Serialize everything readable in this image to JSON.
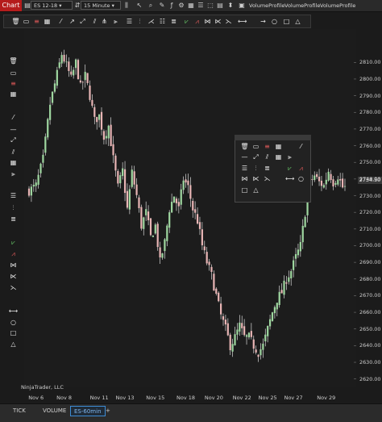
{
  "toolbar": {
    "chart_label": "Chart",
    "instrument": "ES 12-18",
    "interval": "15 Minute",
    "indicators": [
      "VolumeProfile",
      "VolumeProfile",
      "VolumeProfile"
    ]
  },
  "drawing_tools": {
    "top_icons": [
      "cursor-icon",
      "ruler-icon",
      "horizontal-line-icon",
      "fib-icon",
      "ray-icon",
      "trend-channel-icon",
      "andrews-pitchfork-icon",
      "regression-icon",
      "gann-fan-icon",
      "fib-extension-icon",
      "horizontal-lines-icon",
      "buy-arrow-icon",
      "sell-arrow-icon",
      "triangle-shape-icon",
      "rectangle-shape-icon",
      "arrow-line-icon",
      "ellipse-icon",
      "triangle-icon"
    ],
    "left_icons": [
      "trash-icon",
      "ruler-icon",
      "horizontal-line-icon",
      "line-icon",
      "ray-icon",
      "extended-line-icon",
      "channel-icon",
      "pitchfork-icon",
      "fib-retracement-icon",
      "fib-extension-icon",
      "fib-time-icon",
      "fib-circle-icon",
      "buy-marker-icon",
      "sell-marker-icon",
      "region-icon",
      "risk-reward-icon",
      "arrow-line-icon",
      "circle-icon",
      "triangle-icon"
    ]
  },
  "chart": {
    "last_price": "2734.50",
    "watermark": "NinjaTrader, LLC",
    "up_color": "#9fd7a0",
    "down_color": "#e8b5b5"
  },
  "chart_data": {
    "type": "candlestick",
    "ylim": [
      2615,
      2830
    ],
    "y_ticks": [
      2620,
      2630,
      2640,
      2650,
      2660,
      2670,
      2680,
      2690,
      2700,
      2710,
      2720,
      2730,
      2740,
      2750,
      2760,
      2770,
      2780,
      2790,
      2800,
      2810
    ],
    "y_tick_labels": [
      "2620.00",
      "2630.00",
      "2640.00",
      "2650.00",
      "2660.00",
      "2670.00",
      "2680.00",
      "2690.00",
      "2700.00",
      "2710.00",
      "2720.00",
      "2730.00",
      "2740.00",
      "2750.00",
      "2760.00",
      "2770.00",
      "2780.00",
      "2790.00",
      "2800.00",
      "2810.00"
    ],
    "x_tick_labels": [
      "Nov 6",
      "Nov 8",
      "Nov 11",
      "Nov 13",
      "Nov 15",
      "Nov 18",
      "Nov 20",
      "Nov 22",
      "Nov 25",
      "Nov 27",
      "Nov 29"
    ],
    "x_tick_index": [
      3,
      15,
      30,
      41,
      54,
      67,
      79,
      91,
      102,
      113,
      127
    ],
    "close_path": [
      [
        0,
        2733
      ],
      [
        3,
        2736
      ],
      [
        6,
        2752
      ],
      [
        9,
        2785
      ],
      [
        12,
        2803
      ],
      [
        14,
        2815
      ],
      [
        16,
        2808
      ],
      [
        18,
        2800
      ],
      [
        20,
        2810
      ],
      [
        22,
        2795
      ],
      [
        24,
        2802
      ],
      [
        26,
        2790
      ],
      [
        28,
        2775
      ],
      [
        30,
        2778
      ],
      [
        32,
        2765
      ],
      [
        34,
        2772
      ],
      [
        36,
        2752
      ],
      [
        38,
        2735
      ],
      [
        40,
        2745
      ],
      [
        42,
        2722
      ],
      [
        44,
        2744
      ],
      [
        46,
        2730
      ],
      [
        48,
        2712
      ],
      [
        50,
        2720
      ],
      [
        52,
        2705
      ],
      [
        54,
        2712
      ],
      [
        56,
        2690
      ],
      [
        58,
        2702
      ],
      [
        60,
        2722
      ],
      [
        62,
        2730
      ],
      [
        64,
        2722
      ],
      [
        66,
        2740
      ],
      [
        68,
        2735
      ],
      [
        70,
        2722
      ],
      [
        72,
        2715
      ],
      [
        74,
        2700
      ],
      [
        76,
        2690
      ],
      [
        78,
        2682
      ],
      [
        80,
        2670
      ],
      [
        82,
        2658
      ],
      [
        84,
        2650
      ],
      [
        86,
        2640
      ],
      [
        88,
        2645
      ],
      [
        90,
        2652
      ],
      [
        92,
        2645
      ],
      [
        94,
        2645
      ],
      [
        96,
        2640
      ],
      [
        98,
        2636
      ],
      [
        100,
        2640
      ],
      [
        102,
        2650
      ],
      [
        104,
        2660
      ],
      [
        106,
        2668
      ],
      [
        108,
        2672
      ],
      [
        110,
        2680
      ],
      [
        112,
        2685
      ],
      [
        114,
        2693
      ],
      [
        116,
        2700
      ],
      [
        118,
        2720
      ],
      [
        120,
        2738
      ],
      [
        122,
        2742
      ],
      [
        124,
        2738
      ],
      [
        126,
        2736
      ],
      [
        128,
        2745
      ],
      [
        130,
        2738
      ],
      [
        132,
        2742
      ],
      [
        134,
        2735
      ]
    ]
  },
  "float_panel": {
    "icons": [
      "trash-icon",
      "ruler-icon",
      "horizontal-line-icon",
      "fib-icon",
      "line-icon",
      "ray-icon",
      "extended-line-icon",
      "channel-icon",
      "pitchfork-icon",
      "fib-retracement-icon",
      "fib-extension-icon",
      "fib-time-icon",
      "fib-circle-icon",
      "buy-marker-icon",
      "sell-marker-icon",
      "region-icon",
      "risk-reward-icon",
      "arrow-line-icon",
      "ellipse-icon",
      "rectangle-icon",
      "triangle-icon"
    ]
  },
  "tabs": [
    {
      "label": "TICK"
    },
    {
      "label": "VOLUME"
    },
    {
      "label": "ES-60min"
    },
    {
      "label": "+"
    }
  ]
}
